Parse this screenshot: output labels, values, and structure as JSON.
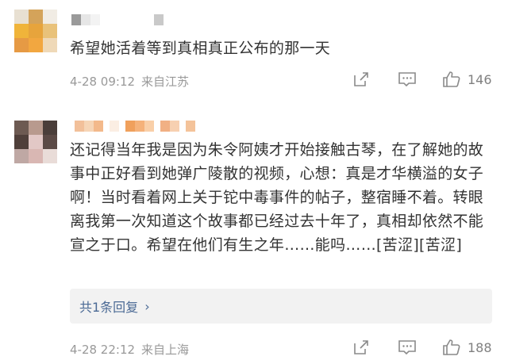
{
  "comments": [
    {
      "text": "希望她活着等到真相真正公布的那一天",
      "date": "4-28 09:12",
      "source": "来自江苏",
      "likes": "146"
    },
    {
      "text": "还记得当年我是因为朱令阿姨才开始接触古琴，在了解她的故事中正好看到她弹广陵散的视频，心想：真是才华横溢的女子啊！当时看着网上关于铊中毒事件的帖子，整宿睡不着。转眼离我第一次知道这个故事都已经过去十年了，真相却依然不能宣之于口。希望在他们有生之年……能吗……[苦涩][苦涩]",
      "reply_link": "共1条回复",
      "reply_chevron": "›",
      "date": "4-28 22:12",
      "source": "来自上海",
      "likes": "188"
    }
  ],
  "icons": [
    "share-icon",
    "comment-icon",
    "like-icon",
    "chevron-right-icon"
  ],
  "colors": {
    "text": "#333333",
    "meta": "#999999",
    "link": "#4b6a95",
    "reply_bg": "#f2f2f2"
  }
}
